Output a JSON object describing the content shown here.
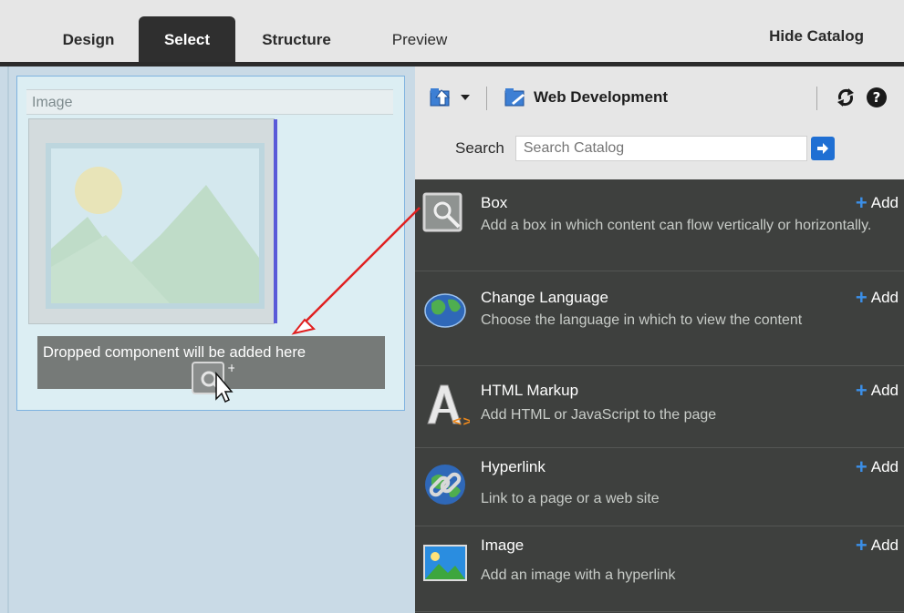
{
  "tabs": [
    {
      "label": "Design",
      "active": false
    },
    {
      "label": "Select",
      "active": true
    },
    {
      "label": "Structure",
      "active": false
    },
    {
      "label": "Preview",
      "active": false
    }
  ],
  "hide_catalog_label": "Hide Catalog",
  "canvas": {
    "component_label": "Image",
    "drop_hint": "Dropped component will be added here"
  },
  "catalog": {
    "folder_label": "Web Development",
    "search_label": "Search",
    "search_placeholder": "Search Catalog",
    "add_label": "Add",
    "items": [
      {
        "title": "Box",
        "description": "Add a box in which content can flow vertically or horizontally.",
        "icon": "box-wrench-icon"
      },
      {
        "title": "Change Language",
        "description": "Choose the language in which to view the content",
        "icon": "globe-icon"
      },
      {
        "title": "HTML Markup",
        "description": "Add HTML or JavaScript to the page",
        "icon": "html-markup-icon"
      },
      {
        "title": "Hyperlink",
        "description": "Link to a page or a web site",
        "icon": "hyperlink-globe-icon"
      },
      {
        "title": "Image",
        "description": "Add an image with a hyperlink",
        "icon": "image-icon"
      }
    ]
  },
  "colors": {
    "tab_active_bg": "#2f2f2f",
    "catalog_bg": "#3e403e",
    "canvas_bg": "#c9dae6",
    "accent_blue": "#1f6fd3",
    "guide_arrow": "#e02020"
  }
}
